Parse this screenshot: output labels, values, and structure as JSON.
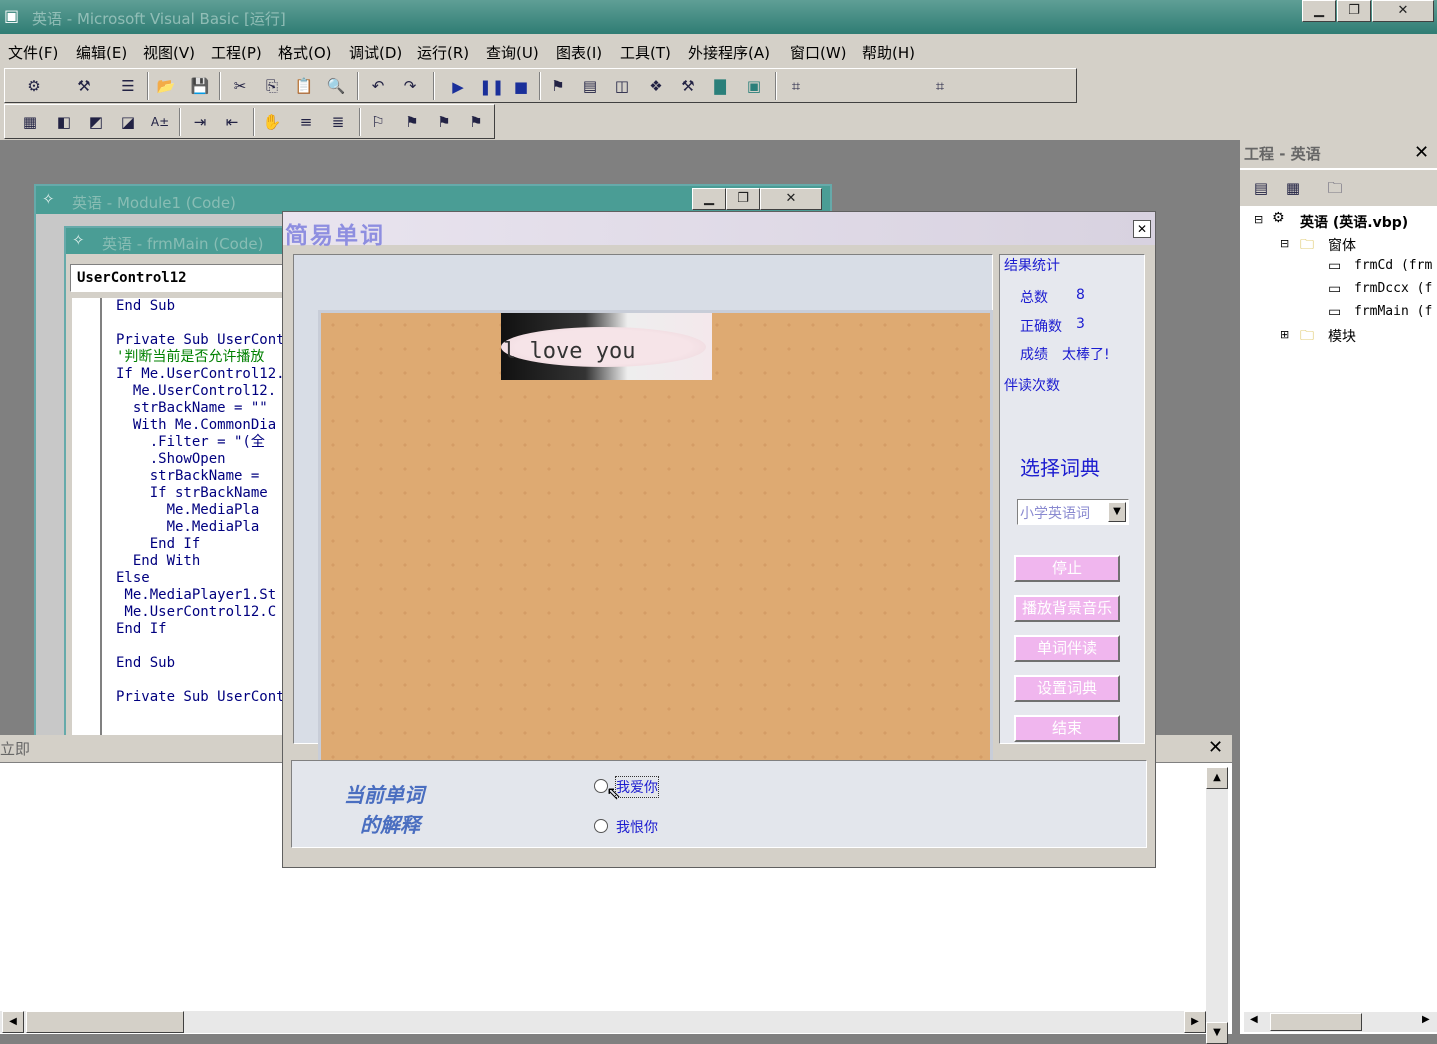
{
  "window": {
    "title": "英语 - Microsoft Visual Basic [运行]"
  },
  "menu": [
    "文件(F)",
    "编辑(E)",
    "视图(V)",
    "工程(P)",
    "格式(O)",
    "调试(D)",
    "运行(R)",
    "查询(U)",
    "图表(I)",
    "工具(T)",
    "外接程序(A)",
    "窗口(W)",
    "帮助(H)"
  ],
  "code_windows": {
    "module_title": "英语 - Module1 (Code)",
    "form_code_title": "英语 - frmMain (Code)",
    "object_combo": "UserControl12",
    "lines": [
      {
        "text": "End Sub",
        "cls": ""
      },
      {
        "text": "",
        "cls": ""
      },
      {
        "text": "Private Sub UserCont",
        "cls": ""
      },
      {
        "text": "'判断当前是否允许播放",
        "cls": "green"
      },
      {
        "text": "If Me.UserControl12.",
        "cls": ""
      },
      {
        "text": "  Me.UserControl12.",
        "cls": ""
      },
      {
        "text": "  strBackName = \"\"",
        "cls": ""
      },
      {
        "text": "  With Me.CommonDia",
        "cls": ""
      },
      {
        "text": "    .Filter = \"(全",
        "cls": ""
      },
      {
        "text": "    .ShowOpen",
        "cls": ""
      },
      {
        "text": "    strBackName =",
        "cls": ""
      },
      {
        "text": "    If strBackName",
        "cls": ""
      },
      {
        "text": "      Me.MediaPla",
        "cls": ""
      },
      {
        "text": "      Me.MediaPla",
        "cls": ""
      },
      {
        "text": "    End If",
        "cls": ""
      },
      {
        "text": "  End With",
        "cls": ""
      },
      {
        "text": "Else",
        "cls": ""
      },
      {
        "text": " Me.MediaPlayer1.St",
        "cls": ""
      },
      {
        "text": " Me.UserControl12.C",
        "cls": ""
      },
      {
        "text": "End If",
        "cls": ""
      },
      {
        "text": "",
        "cls": ""
      },
      {
        "text": "End Sub",
        "cls": ""
      },
      {
        "text": "",
        "cls": ""
      },
      {
        "text": "Private Sub UserCont",
        "cls": ""
      }
    ]
  },
  "form": {
    "title": "简易单词",
    "word_image_text": "l love you",
    "stats_title": "结果统计",
    "total_label": "总数",
    "total_value": "8",
    "correct_label": "正确数",
    "correct_value": "3",
    "score_label": "成绩",
    "score_value": "太棒了!",
    "read_count_label": "伴读次数",
    "dict_label": "选择词典",
    "dict_selected": "小学英语词",
    "buttons": {
      "stop": "停止",
      "play_music": "播放背景音乐",
      "read_along": "单词伴读",
      "set_dict": "设置词典",
      "end": "结束"
    },
    "meaning_label_line1": "当前单词",
    "meaning_label_line2": "的解释",
    "options": [
      "我爱你",
      "我恨你"
    ]
  },
  "immediate": {
    "title": "立即"
  },
  "project": {
    "title": "工程 - 英语",
    "root": "英语 (英语.vbp)",
    "forms_folder": "窗体",
    "forms": [
      "frmCd (frm",
      "frmDccx (f",
      "frmMain (f"
    ],
    "modules_folder": "模块"
  },
  "colors": {
    "accent_title": "#2f7d74",
    "stage": "#deaa72",
    "button_pink": "#f0b6ee",
    "label_blue": "#1c1cd0"
  }
}
